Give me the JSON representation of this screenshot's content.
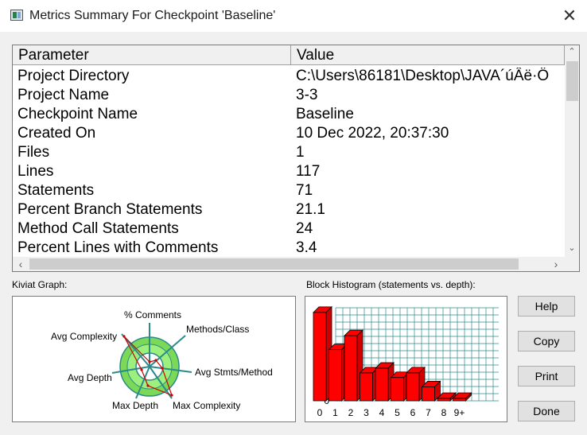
{
  "window": {
    "title": "Metrics Summary For Checkpoint 'Baseline'",
    "close_glyph": "✕"
  },
  "table": {
    "headers": {
      "parameter": "Parameter",
      "value": "Value"
    },
    "rows": [
      {
        "parameter": "Project Directory",
        "value": "C:\\Users\\86181\\Desktop\\JAVA´úÂë·Ö"
      },
      {
        "parameter": "Project Name",
        "value": "3-3"
      },
      {
        "parameter": "Checkpoint Name",
        "value": "Baseline"
      },
      {
        "parameter": "Created On",
        "value": "10 Dec 2022, 20:37:30"
      },
      {
        "parameter": "Files",
        "value": "1"
      },
      {
        "parameter": "Lines",
        "value": "117"
      },
      {
        "parameter": "Statements",
        "value": "71"
      },
      {
        "parameter": "Percent Branch Statements",
        "value": "21.1"
      },
      {
        "parameter": "Method Call Statements",
        "value": "24"
      },
      {
        "parameter": "Percent Lines with Comments",
        "value": "3.4"
      }
    ]
  },
  "kiviat": {
    "label": "Kiviat Graph:",
    "axes": [
      "% Comments",
      "Methods/Class",
      "Avg Stmts/Method",
      "Max Complexity",
      "Max Depth",
      "Avg Depth",
      "Avg Complexity"
    ]
  },
  "histogram": {
    "label": "Block Histogram (statements vs. depth):",
    "y_ticks": [
      "0",
      "5",
      "10",
      "15"
    ],
    "categories": [
      "0",
      "1",
      "2",
      "3",
      "4",
      "5",
      "6",
      "7",
      "8",
      "9+"
    ],
    "values": [
      19,
      11,
      14,
      6,
      7,
      5,
      6,
      3,
      0,
      0
    ],
    "ylim": [
      0,
      20
    ],
    "bar_color": "#ff0000"
  },
  "buttons": {
    "help": "Help",
    "copy": "Copy",
    "print": "Print",
    "done": "Done"
  }
}
